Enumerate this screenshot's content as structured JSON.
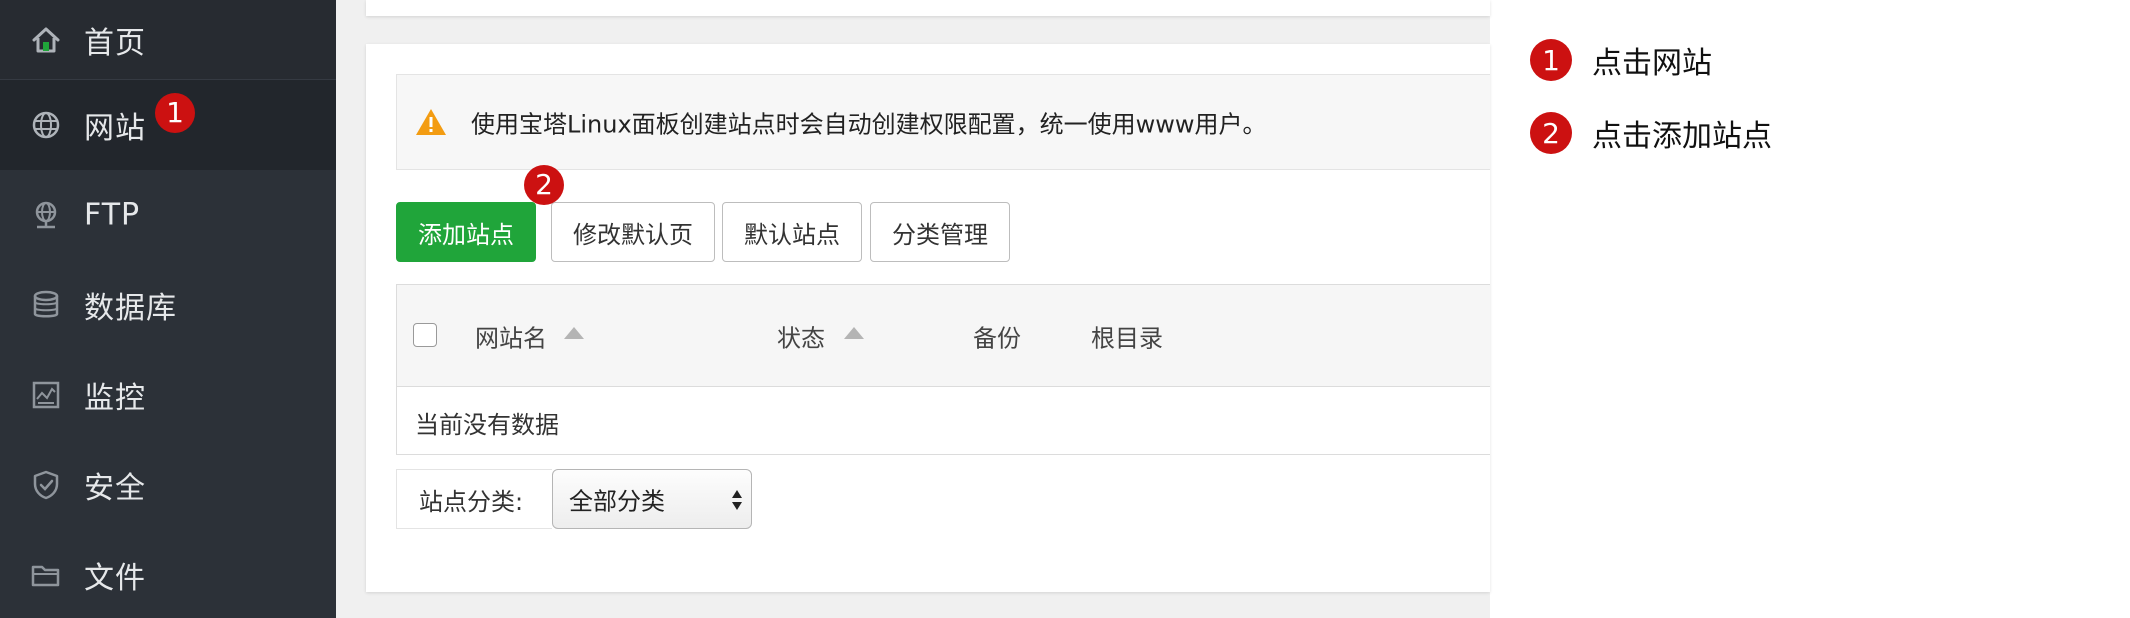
{
  "sidebar": {
    "items": [
      {
        "label": "首页",
        "icon": "home-icon"
      },
      {
        "label": "网站",
        "icon": "globe-icon"
      },
      {
        "label": "FTP",
        "icon": "ftp-icon"
      },
      {
        "label": "数据库",
        "icon": "database-icon"
      },
      {
        "label": "监控",
        "icon": "monitor-icon"
      },
      {
        "label": "安全",
        "icon": "shield-icon"
      },
      {
        "label": "文件",
        "icon": "folder-icon"
      }
    ],
    "active_index": 1
  },
  "alert": {
    "text": "使用宝塔Linux面板创建站点时会自动创建权限配置，统一使用www用户。",
    "icon": "warning-icon"
  },
  "toolbar": {
    "add_site": "添加站点",
    "modify_default_page": "修改默认页",
    "default_site": "默认站点",
    "category_manage": "分类管理"
  },
  "table": {
    "columns": [
      "网站名",
      "状态",
      "备份",
      "根目录"
    ],
    "empty_text": "当前没有数据"
  },
  "filter": {
    "label": "站点分类:",
    "selected": "全部分类"
  },
  "annotations": {
    "badge1": "1",
    "badge2": "2",
    "steps": [
      {
        "number": "1",
        "text": "点击网站"
      },
      {
        "number": "2",
        "text": "点击添加站点"
      }
    ]
  },
  "colors": {
    "sidebar_bg": "#2c3138",
    "primary_green": "#20a53a",
    "badge_red": "#cc1111",
    "warning_orange": "#f39c12"
  }
}
